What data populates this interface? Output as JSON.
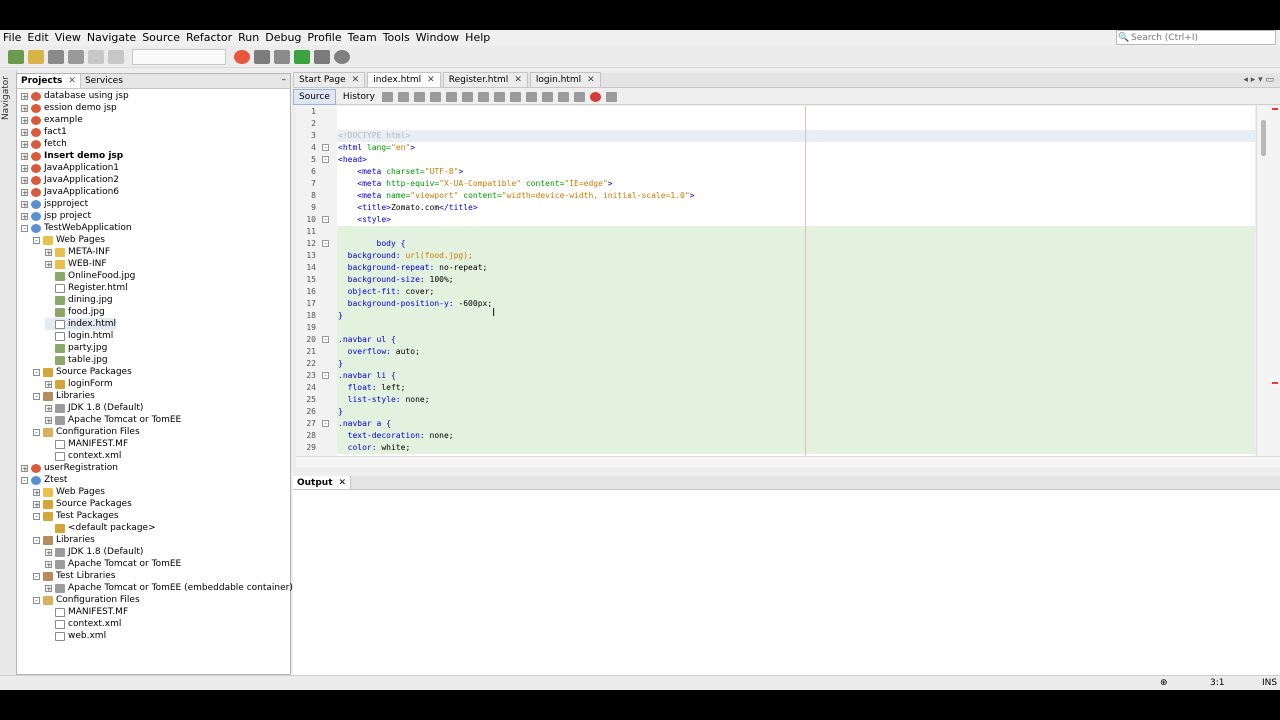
{
  "menu": [
    "File",
    "Edit",
    "View",
    "Navigate",
    "Source",
    "Refactor",
    "Run",
    "Debug",
    "Profile",
    "Team",
    "Tools",
    "Window",
    "Help"
  ],
  "search_placeholder": "Search (Ctrl+I)",
  "left_strip_label": "Navigator",
  "projects": {
    "tabs": [
      "Projects",
      "Services"
    ],
    "tree": [
      {
        "label": "database using jsp",
        "icon": "cup-icon",
        "depth": 0,
        "toggle": "+"
      },
      {
        "label": "ession demo jsp",
        "icon": "cup-icon",
        "depth": 0,
        "toggle": "+"
      },
      {
        "label": "example",
        "icon": "cup-icon",
        "depth": 0,
        "toggle": "+"
      },
      {
        "label": "fact1",
        "icon": "cup-icon",
        "depth": 0,
        "toggle": "+"
      },
      {
        "label": "fetch",
        "icon": "cup-icon",
        "depth": 0,
        "toggle": "+"
      },
      {
        "label": "Insert demo jsp",
        "icon": "cup-icon",
        "depth": 0,
        "toggle": "+",
        "bold": true
      },
      {
        "label": "JavaApplication1",
        "icon": "cup-icon",
        "depth": 0,
        "toggle": "+"
      },
      {
        "label": "JavaApplication2",
        "icon": "cup-icon",
        "depth": 0,
        "toggle": "+"
      },
      {
        "label": "JavaApplication6",
        "icon": "cup-icon",
        "depth": 0,
        "toggle": "+"
      },
      {
        "label": "jspproject",
        "icon": "globe-icon",
        "depth": 0,
        "toggle": "+"
      },
      {
        "label": "jsp project",
        "icon": "globe-icon",
        "depth": 0,
        "toggle": "+"
      },
      {
        "label": "TestWebApplication",
        "icon": "globe-icon",
        "depth": 0,
        "toggle": "-"
      },
      {
        "label": "Web Pages",
        "icon": "folder-icon",
        "depth": 1,
        "toggle": "-"
      },
      {
        "label": "META-INF",
        "icon": "folder-icon",
        "depth": 2,
        "toggle": "+"
      },
      {
        "label": "WEB-INF",
        "icon": "folder-icon",
        "depth": 2,
        "toggle": "+"
      },
      {
        "label": "OnlineFood.jpg",
        "icon": "image-file-icon",
        "depth": 2,
        "toggle": ""
      },
      {
        "label": "Register.html",
        "icon": "html-file-icon",
        "depth": 2,
        "toggle": ""
      },
      {
        "label": "dining.jpg",
        "icon": "image-file-icon",
        "depth": 2,
        "toggle": ""
      },
      {
        "label": "food.jpg",
        "icon": "image-file-icon",
        "depth": 2,
        "toggle": ""
      },
      {
        "label": "index.html",
        "icon": "html-file-icon",
        "depth": 2,
        "toggle": "",
        "selected": true
      },
      {
        "label": "login.html",
        "icon": "html-file-icon",
        "depth": 2,
        "toggle": ""
      },
      {
        "label": "party.jpg",
        "icon": "image-file-icon",
        "depth": 2,
        "toggle": ""
      },
      {
        "label": "table.jpg",
        "icon": "image-file-icon",
        "depth": 2,
        "toggle": ""
      },
      {
        "label": "Source Packages",
        "icon": "package-folder-icon",
        "depth": 1,
        "toggle": "-"
      },
      {
        "label": "loginForm",
        "icon": "package-icon",
        "depth": 2,
        "toggle": "+"
      },
      {
        "label": "Libraries",
        "icon": "library-icon",
        "depth": 1,
        "toggle": "-"
      },
      {
        "label": "JDK 1.8 (Default)",
        "icon": "jar-icon",
        "depth": 2,
        "toggle": "+"
      },
      {
        "label": "Apache Tomcat or TomEE",
        "icon": "jar-icon",
        "depth": 2,
        "toggle": "+"
      },
      {
        "label": "Configuration Files",
        "icon": "config-folder-icon",
        "depth": 1,
        "toggle": "-"
      },
      {
        "label": "MANIFEST.MF",
        "icon": "text-file-icon",
        "depth": 2,
        "toggle": ""
      },
      {
        "label": "context.xml",
        "icon": "xml-file-icon",
        "depth": 2,
        "toggle": ""
      },
      {
        "label": "userRegistration",
        "icon": "cup-icon",
        "depth": 0,
        "toggle": "+"
      },
      {
        "label": "Ztest",
        "icon": "globe-icon",
        "depth": 0,
        "toggle": "-"
      },
      {
        "label": "Web Pages",
        "icon": "folder-icon",
        "depth": 1,
        "toggle": "+"
      },
      {
        "label": "Source Packages",
        "icon": "package-folder-icon",
        "depth": 1,
        "toggle": "+"
      },
      {
        "label": "Test Packages",
        "icon": "package-folder-icon",
        "depth": 1,
        "toggle": "-"
      },
      {
        "label": "<default package>",
        "icon": "package-icon",
        "depth": 2,
        "toggle": ""
      },
      {
        "label": "Libraries",
        "icon": "library-icon",
        "depth": 1,
        "toggle": "-"
      },
      {
        "label": "JDK 1.8 (Default)",
        "icon": "jar-icon",
        "depth": 2,
        "toggle": "+"
      },
      {
        "label": "Apache Tomcat or TomEE",
        "icon": "jar-icon",
        "depth": 2,
        "toggle": "+"
      },
      {
        "label": "Test Libraries",
        "icon": "library-icon",
        "depth": 1,
        "toggle": "-"
      },
      {
        "label": "Apache Tomcat or TomEE (embeddable container)",
        "icon": "jar-icon",
        "depth": 2,
        "toggle": "+"
      },
      {
        "label": "Configuration Files",
        "icon": "config-folder-icon",
        "depth": 1,
        "toggle": "-"
      },
      {
        "label": "MANIFEST.MF",
        "icon": "text-file-icon",
        "depth": 2,
        "toggle": ""
      },
      {
        "label": "context.xml",
        "icon": "xml-file-icon",
        "depth": 2,
        "toggle": ""
      },
      {
        "label": "web.xml",
        "icon": "xml-file-icon",
        "depth": 2,
        "toggle": ""
      }
    ]
  },
  "editor": {
    "tabs": [
      "Start Page",
      "index.html",
      "Register.html",
      "login.html"
    ],
    "active_tab": "index.html",
    "source_label": "Source",
    "history_label": "History",
    "lines": [
      {
        "n": 1,
        "fold": "",
        "segs": []
      },
      {
        "n": 2,
        "fold": "",
        "segs": []
      },
      {
        "n": 3,
        "fold": "",
        "segs": [
          {
            "t": "<!DOCTYPE html>",
            "c": "doc"
          }
        ]
      },
      {
        "n": 4,
        "fold": "-",
        "segs": [
          {
            "t": "<html",
            "c": "tag"
          },
          {
            "t": " lang=",
            "c": "attr"
          },
          {
            "t": "\"en\"",
            "c": "str"
          },
          {
            "t": ">",
            "c": "tag"
          }
        ]
      },
      {
        "n": 5,
        "fold": "-",
        "segs": [
          {
            "t": "<head>",
            "c": "tag"
          }
        ]
      },
      {
        "n": 6,
        "fold": "",
        "segs": [
          {
            "t": "    <meta",
            "c": "tag"
          },
          {
            "t": " charset=",
            "c": "attr"
          },
          {
            "t": "\"UTF-8\"",
            "c": "str"
          },
          {
            "t": ">",
            "c": "tag"
          }
        ]
      },
      {
        "n": 7,
        "fold": "",
        "segs": [
          {
            "t": "    <meta",
            "c": "tag"
          },
          {
            "t": " http-equiv=",
            "c": "attr"
          },
          {
            "t": "\"X-UA-Compatible\"",
            "c": "str"
          },
          {
            "t": " content=",
            "c": "attr"
          },
          {
            "t": "\"IE=edge\"",
            "c": "str"
          },
          {
            "t": ">",
            "c": "tag"
          }
        ]
      },
      {
        "n": 8,
        "fold": "",
        "segs": [
          {
            "t": "    <meta",
            "c": "tag"
          },
          {
            "t": " name=",
            "c": "attr"
          },
          {
            "t": "\"viewport\"",
            "c": "str"
          },
          {
            "t": " content=",
            "c": "attr"
          },
          {
            "t": "\"width=device-width, initial-scale=1.0\"",
            "c": "str"
          },
          {
            "t": ">",
            "c": "tag"
          }
        ]
      },
      {
        "n": 9,
        "fold": "",
        "segs": [
          {
            "t": "    <title>",
            "c": "tag"
          },
          {
            "t": "Zomato.com",
            "c": "val"
          },
          {
            "t": "</title>",
            "c": "tag"
          }
        ]
      },
      {
        "n": 10,
        "fold": "-",
        "segs": [
          {
            "t": "    <style>",
            "c": "tag"
          }
        ]
      },
      {
        "n": 11,
        "fold": "",
        "segs": []
      },
      {
        "n": 12,
        "fold": "-",
        "segs": [
          {
            "t": "        body {",
            "c": "sel"
          }
        ]
      },
      {
        "n": 13,
        "fold": "",
        "segs": [
          {
            "t": "  background: ",
            "c": "prop"
          },
          {
            "t": "url(food.jpg);",
            "c": "str"
          }
        ]
      },
      {
        "n": 14,
        "fold": "",
        "segs": [
          {
            "t": "  background-repeat: ",
            "c": "prop"
          },
          {
            "t": "no-repeat;",
            "c": "val"
          }
        ]
      },
      {
        "n": 15,
        "fold": "",
        "segs": [
          {
            "t": "  background-size: ",
            "c": "prop"
          },
          {
            "t": "100%;",
            "c": "val"
          }
        ]
      },
      {
        "n": 16,
        "fold": "",
        "segs": [
          {
            "t": "  object-fit: ",
            "c": "prop"
          },
          {
            "t": "cover;",
            "c": "val"
          }
        ]
      },
      {
        "n": 17,
        "fold": "",
        "segs": [
          {
            "t": "  background-position-y: ",
            "c": "prop"
          },
          {
            "t": "-600px;",
            "c": "val"
          }
        ]
      },
      {
        "n": 18,
        "fold": "",
        "segs": [
          {
            "t": "}",
            "c": "sel"
          }
        ]
      },
      {
        "n": 19,
        "fold": "",
        "segs": []
      },
      {
        "n": 20,
        "fold": "-",
        "segs": [
          {
            "t": ".navbar ul {",
            "c": "sel"
          }
        ]
      },
      {
        "n": 21,
        "fold": "",
        "segs": [
          {
            "t": "  overflow: ",
            "c": "prop"
          },
          {
            "t": "auto;",
            "c": "val"
          }
        ]
      },
      {
        "n": 22,
        "fold": "",
        "segs": [
          {
            "t": "}",
            "c": "sel"
          }
        ]
      },
      {
        "n": 23,
        "fold": "-",
        "segs": [
          {
            "t": ".navbar li {",
            "c": "sel"
          }
        ]
      },
      {
        "n": 24,
        "fold": "",
        "segs": [
          {
            "t": "  float: ",
            "c": "prop"
          },
          {
            "t": "left;",
            "c": "val"
          }
        ]
      },
      {
        "n": 25,
        "fold": "",
        "segs": [
          {
            "t": "  list-style: ",
            "c": "prop"
          },
          {
            "t": "none;",
            "c": "val"
          }
        ]
      },
      {
        "n": 26,
        "fold": "",
        "segs": [
          {
            "t": "}",
            "c": "sel"
          }
        ]
      },
      {
        "n": 27,
        "fold": "-",
        "segs": [
          {
            "t": ".navbar a {",
            "c": "sel"
          }
        ]
      },
      {
        "n": 28,
        "fold": "",
        "segs": [
          {
            "t": "  text-decoration: ",
            "c": "prop"
          },
          {
            "t": "none;",
            "c": "val"
          }
        ]
      },
      {
        "n": 29,
        "fold": "",
        "segs": [
          {
            "t": "  color: ",
            "c": "prop"
          },
          {
            "t": "white;",
            "c": "val"
          }
        ]
      }
    ]
  },
  "output_tab": "Output",
  "status": {
    "position": "3:1",
    "mode": "INS"
  }
}
